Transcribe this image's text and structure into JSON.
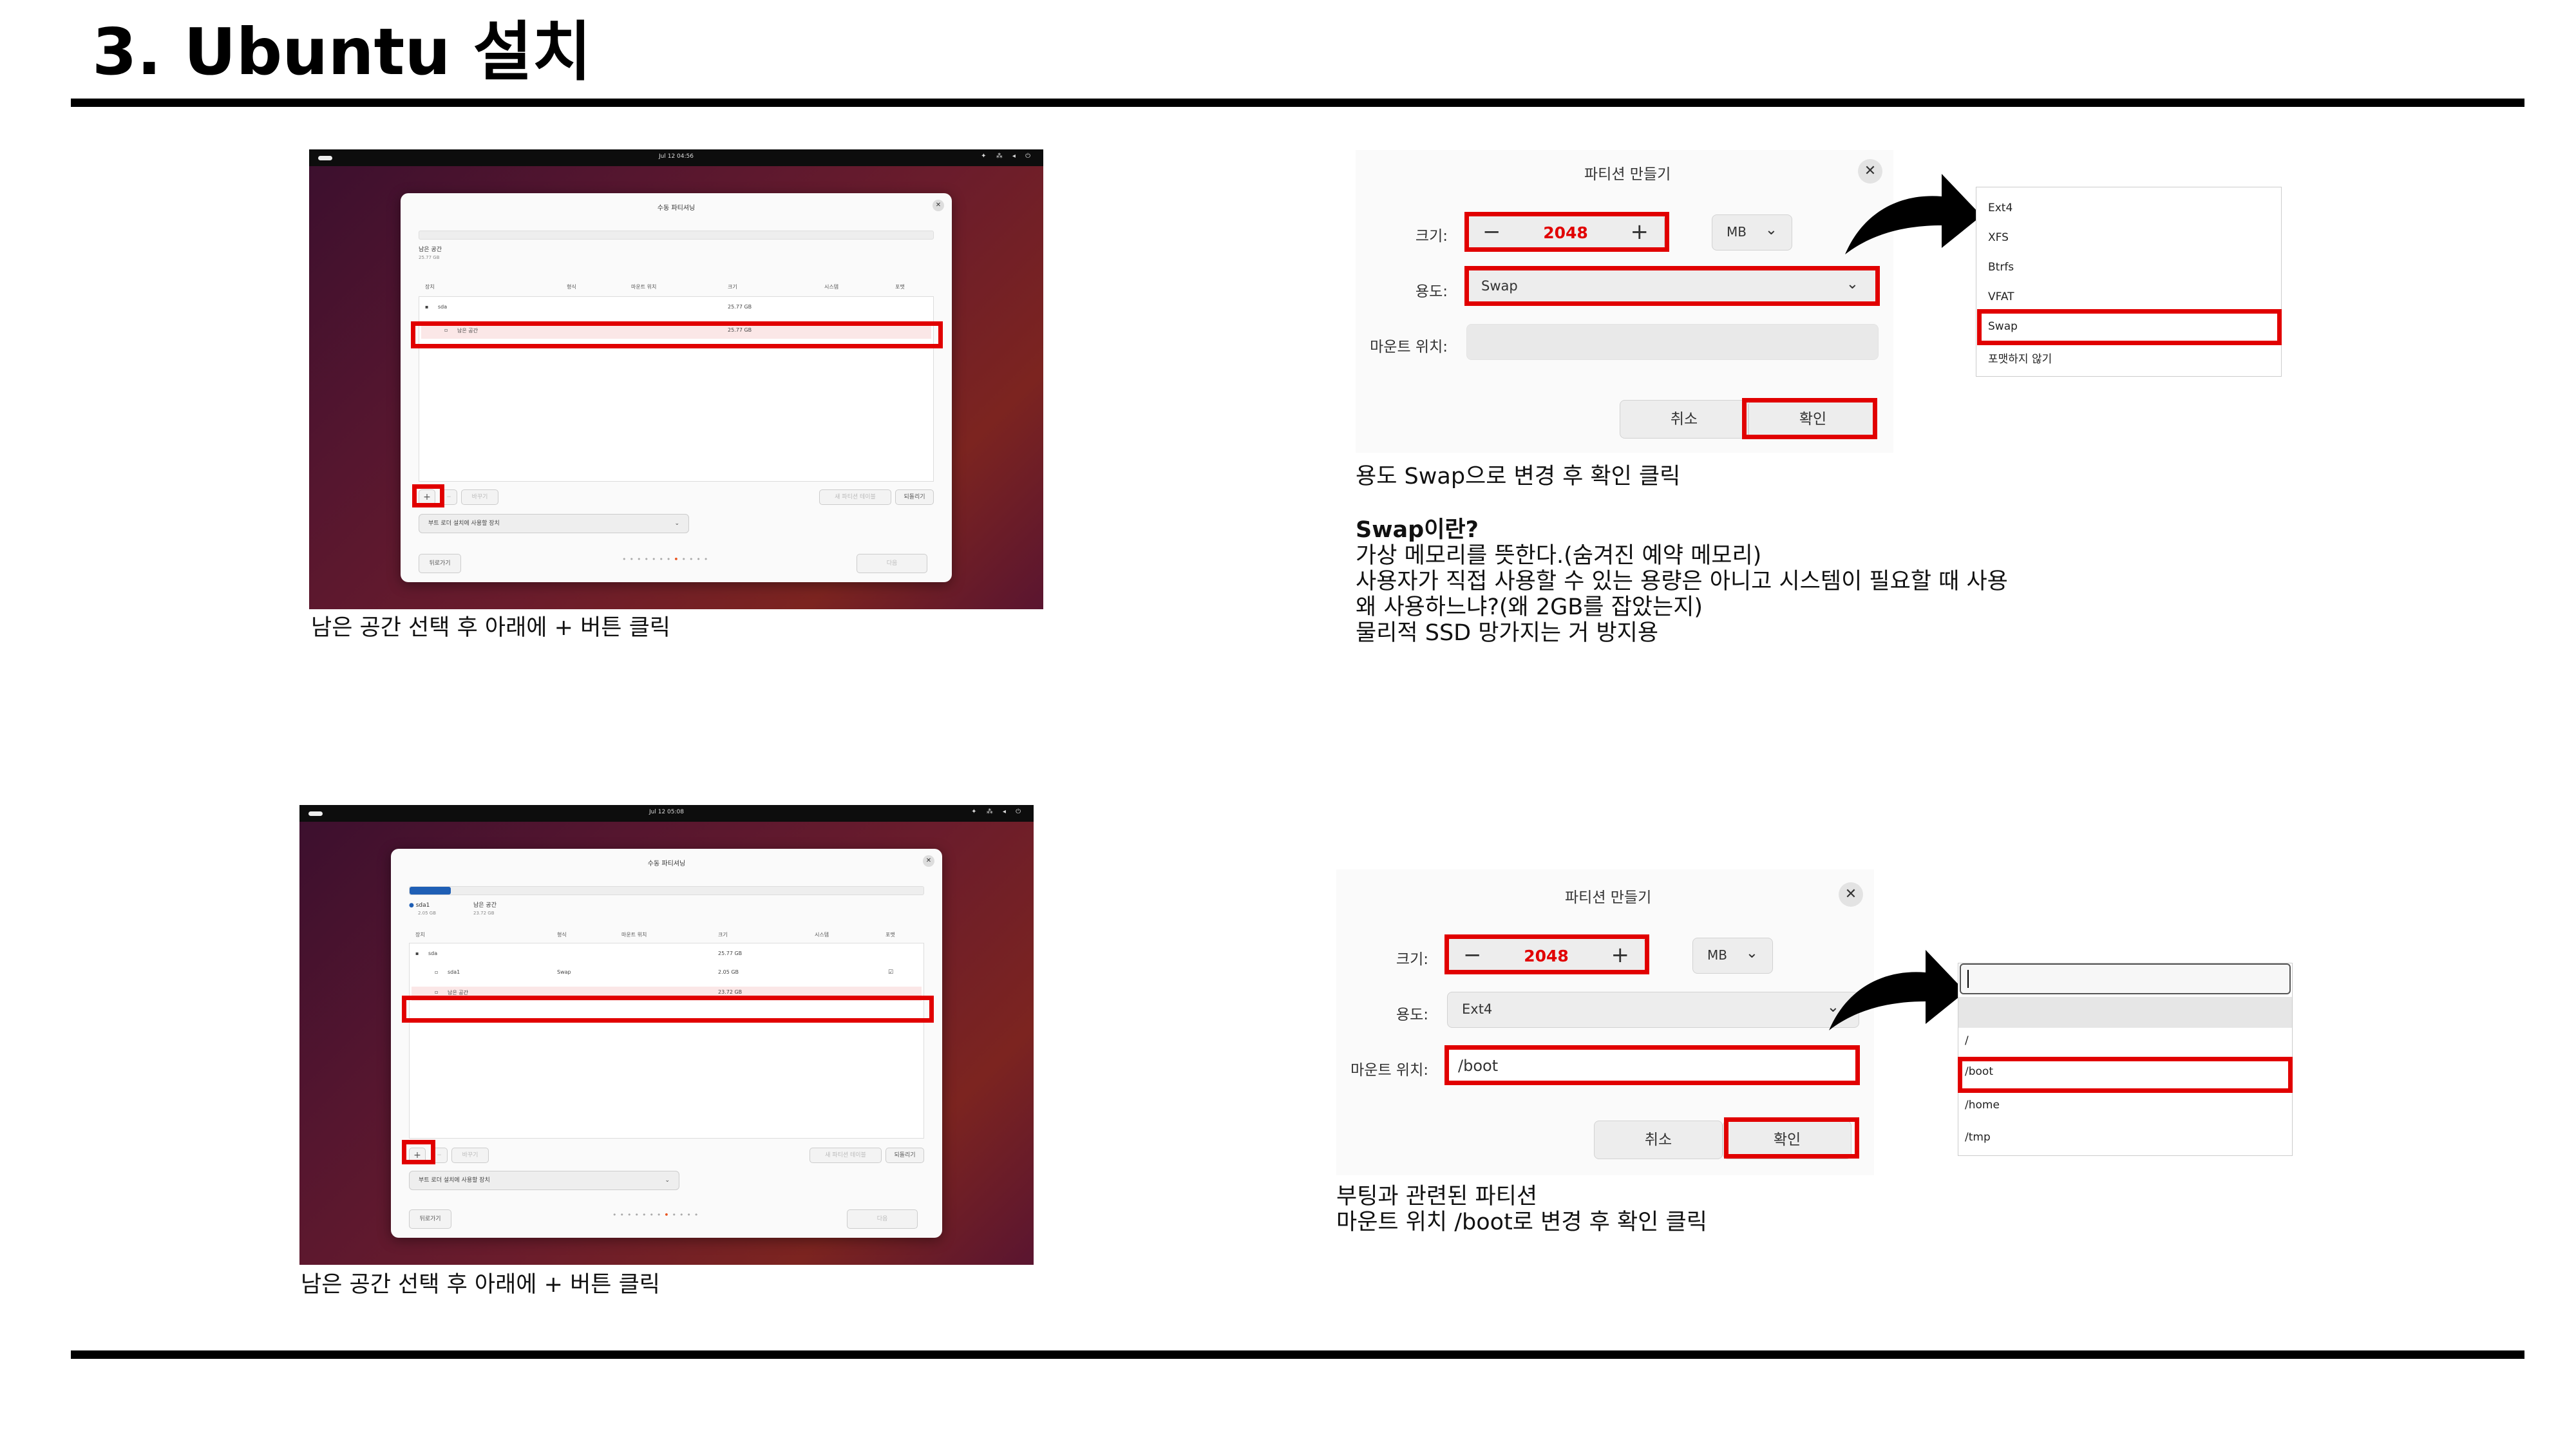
{
  "slide": {
    "title": "3. Ubuntu 설치"
  },
  "shot1": {
    "clock": "Jul 12 04:56",
    "dialog_title": "수동 파티셔닝",
    "free_space_label": "남은 공간",
    "free_space_size": "25.77 GB",
    "columns": [
      "장치",
      "형식",
      "마운트 위치",
      "크기",
      "시스템",
      "포맷"
    ],
    "rows": [
      {
        "device": "sda",
        "type": "",
        "mount": "",
        "size": "25.77 GB"
      },
      {
        "device": "남은 공간",
        "type": "",
        "mount": "",
        "size": "25.77 GB"
      }
    ],
    "add_button": "+",
    "remove_button": "−",
    "modify_button": "바꾸기",
    "new_table_button": "새 파티션 테이블",
    "revert_button": "되돌리기",
    "boot_loader_dropdown": "부트 로더 설치에 사용할 장치",
    "back_button": "뒤로가기",
    "next_button": "다음",
    "caption": "남은 공간 선택 후 아래에 + 버튼 클릭"
  },
  "shot2": {
    "clock": "Jul 12 05:08",
    "dialog_title": "수동 파티셔닝",
    "legend_1_name": "sda1",
    "legend_1_size": "2.05 GB",
    "legend_2_name": "남은 공간",
    "legend_2_size": "23.72 GB",
    "columns": [
      "장치",
      "형식",
      "마운트 위치",
      "크기",
      "시스템",
      "포맷"
    ],
    "rows": [
      {
        "device": "sda",
        "type": "",
        "mount": "",
        "size": "25.77 GB"
      },
      {
        "device": "sda1",
        "type": "Swap",
        "mount": "",
        "size": "2.05 GB"
      },
      {
        "device": "남은 공간",
        "type": "",
        "mount": "",
        "size": "23.72 GB"
      }
    ],
    "add_button": "+",
    "remove_button": "−",
    "modify_button": "바꾸기",
    "new_table_button": "새 파티션 테이블",
    "revert_button": "되돌리기",
    "boot_loader_dropdown": "부트 로더 설치에 사용할 장치",
    "back_button": "뒤로가기",
    "next_button": "다음",
    "caption": "남은 공간 선택 후 아래에 + 버튼 클릭"
  },
  "swap_dialog": {
    "title": "파티션 만들기",
    "size_label": "크기:",
    "size_value": "2048",
    "unit": "MB",
    "use_label": "용도:",
    "use_value": "Swap",
    "mount_label": "마운트 위치:",
    "cancel": "취소",
    "ok": "확인",
    "fs_options": [
      "Ext4",
      "XFS",
      "Btrfs",
      "VFAT",
      "Swap",
      "포맷하지 않기"
    ],
    "caption_lines": [
      "용도 Swap으로 변경 후 확인 클릭"
    ],
    "swap_heading": "Swap이란?",
    "swap_lines": [
      "가상 메모리를 뜻한다.(숨겨진 예약 메모리)",
      "사용자가 직접 사용할 수 있는 용량은 아니고 시스템이 필요할 때 사용",
      "왜 사용하느냐?(왜 2GB를 잡았는지)",
      "물리적 SSD 망가지는 거 방지용"
    ]
  },
  "boot_dialog": {
    "title": "파티션 만들기",
    "size_label": "크기:",
    "size_value": "2048",
    "unit": "MB",
    "use_label": "용도:",
    "use_value": "Ext4",
    "mount_label": "마운트 위치:",
    "mount_value": "/boot",
    "cancel": "취소",
    "ok": "확인",
    "mount_options": [
      "/",
      "/boot",
      "/home",
      "/tmp"
    ],
    "caption_lines": [
      "부팅과 관련된 파티션",
      "마운트 위치 /boot로 변경 후 확인 클릭"
    ]
  }
}
